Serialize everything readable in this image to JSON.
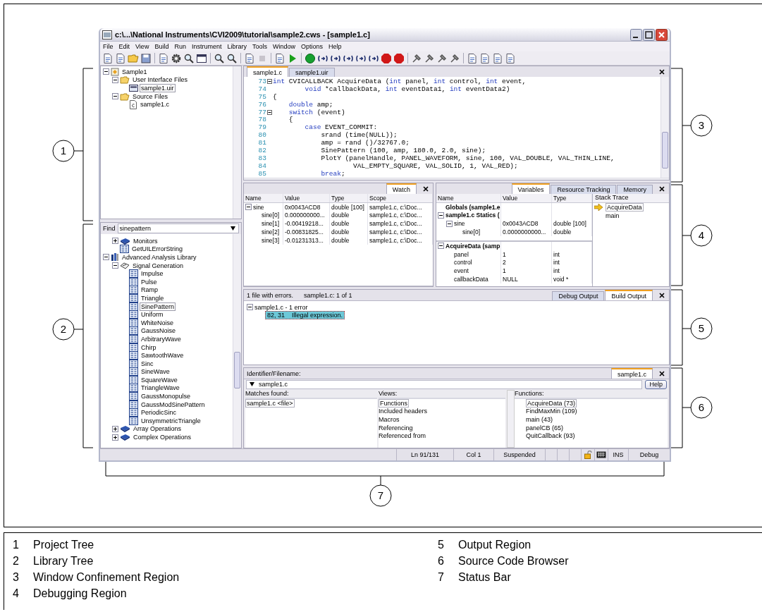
{
  "window": {
    "title": "c:\\...\\National Instruments\\CVI2009\\tutorial\\sample2.cws - [sample1.c]"
  },
  "menu": [
    "File",
    "Edit",
    "View",
    "Build",
    "Run",
    "Instrument",
    "Library",
    "Tools",
    "Window",
    "Options",
    "Help"
  ],
  "project_tree": [
    {
      "label": "Sample1",
      "kind": "project",
      "expanded": true,
      "selected": false,
      "children": [
        {
          "label": "User Interface Files",
          "kind": "folder",
          "expanded": true,
          "selected": false,
          "children": [
            {
              "label": "sample1.uir",
              "kind": "uir",
              "selected": true
            }
          ]
        },
        {
          "label": "Source Files",
          "kind": "folder",
          "expanded": true,
          "selected": false,
          "children": [
            {
              "label": "sample1.c",
              "kind": "c-file",
              "selected": false
            }
          ]
        }
      ]
    }
  ],
  "library": {
    "find_label": "Find",
    "find_value": "sinepattern",
    "tree": [
      {
        "children": [
          {
            "label": "Monitors",
            "kind": "class",
            "expanded": false,
            "selected": false
          },
          {
            "label": "GetUILErrorString",
            "kind": "function",
            "selected": false
          }
        ]
      },
      {
        "label": "Advanced Analysis Library",
        "kind": "library",
        "expanded": true,
        "selected": false,
        "children": [
          {
            "label": "Signal Generation",
            "kind": "category",
            "expanded": true,
            "selected": false,
            "children": [
              {
                "label": "Impulse",
                "kind": "function",
                "selected": false
              },
              {
                "label": "Pulse",
                "kind": "function",
                "selected": false
              },
              {
                "label": "Ramp",
                "kind": "function",
                "selected": false
              },
              {
                "label": "Triangle",
                "kind": "function",
                "selected": false
              },
              {
                "label": "SinePattern",
                "kind": "function",
                "selected": true
              },
              {
                "label": "Uniform",
                "kind": "function",
                "selected": false
              },
              {
                "label": "WhiteNoise",
                "kind": "function",
                "selected": false
              },
              {
                "label": "GaussNoise",
                "kind": "function",
                "selected": false
              },
              {
                "label": "ArbitraryWave",
                "kind": "function",
                "selected": false
              },
              {
                "label": "Chirp",
                "kind": "function",
                "selected": false
              },
              {
                "label": "SawtoothWave",
                "kind": "function",
                "selected": false
              },
              {
                "label": "Sinc",
                "kind": "function",
                "selected": false
              },
              {
                "label": "SineWave",
                "kind": "function",
                "selected": false
              },
              {
                "label": "SquareWave",
                "kind": "function",
                "selected": false
              },
              {
                "label": "TriangleWave",
                "kind": "function",
                "selected": false
              },
              {
                "label": "GaussMonopulse",
                "kind": "function",
                "selected": false
              },
              {
                "label": "GaussModSinePattern",
                "kind": "function",
                "selected": false
              },
              {
                "label": "PeriodicSinc",
                "kind": "function",
                "selected": false
              },
              {
                "label": "UnsymmetricTriangle",
                "kind": "function",
                "selected": false
              }
            ]
          },
          {
            "label": "Array Operations",
            "kind": "class",
            "expanded": false,
            "selected": false
          },
          {
            "label": "Complex Operations",
            "kind": "class",
            "expanded": false,
            "selected": false
          }
        ]
      }
    ]
  },
  "editor": {
    "tabs": [
      {
        "label": "sample1.c",
        "selected": true
      },
      {
        "label": "sample1.uir",
        "selected": false
      }
    ],
    "lines": [
      {
        "num": "73",
        "fold": true,
        "parts": [
          {
            "t": "int",
            "keyword": true
          },
          {
            "t": " CVICALLBACK AcquireData (",
            "keyword": false
          },
          {
            "t": "int",
            "keyword": true
          },
          {
            "t": " panel, ",
            "keyword": false
          },
          {
            "t": "int",
            "keyword": true
          },
          {
            "t": " control, ",
            "keyword": false
          },
          {
            "t": "int",
            "keyword": true
          },
          {
            "t": " event,",
            "keyword": false
          }
        ]
      },
      {
        "num": "74",
        "fold": false,
        "parts": [
          {
            "t": "        void",
            "keyword": true
          },
          {
            "t": " *callbackData, ",
            "keyword": false
          },
          {
            "t": "int",
            "keyword": true
          },
          {
            "t": " eventData1, ",
            "keyword": false
          },
          {
            "t": "int",
            "keyword": true
          },
          {
            "t": " eventData2)",
            "keyword": false
          }
        ]
      },
      {
        "num": "75",
        "fold": false,
        "parts": [
          {
            "t": "{",
            "keyword": false
          }
        ]
      },
      {
        "num": "76",
        "fold": false,
        "parts": [
          {
            "t": "    double",
            "keyword": true
          },
          {
            "t": " amp;",
            "keyword": false
          }
        ]
      },
      {
        "num": "77",
        "fold": true,
        "parts": [
          {
            "t": "    switch",
            "keyword": true
          },
          {
            "t": " (event)",
            "keyword": false
          }
        ]
      },
      {
        "num": "78",
        "fold": false,
        "parts": [
          {
            "t": "    {",
            "keyword": false
          }
        ]
      },
      {
        "num": "79",
        "fold": false,
        "parts": [
          {
            "t": "        case",
            "keyword": true
          },
          {
            "t": " EVENT_COMMIT:",
            "keyword": false
          }
        ]
      },
      {
        "num": "80",
        "fold": false,
        "parts": [
          {
            "t": "            srand (time(NULL));",
            "keyword": false
          }
        ]
      },
      {
        "num": "81",
        "fold": false,
        "parts": [
          {
            "t": "            amp = rand ()/32767.0;",
            "keyword": false
          }
        ]
      },
      {
        "num": "82",
        "fold": false,
        "parts": [
          {
            "t": "            SinePattern (100, amp, 180.0, 2.0, sine);",
            "keyword": false
          }
        ]
      },
      {
        "num": "83",
        "fold": false,
        "parts": [
          {
            "t": "            PlotY (panelHandle, PANEL_WAVEFORM, sine, 100, VAL_DOUBLE, VAL_THIN_LINE,",
            "keyword": false
          }
        ]
      },
      {
        "num": "84",
        "fold": false,
        "parts": [
          {
            "t": "                    VAL_EMPTY_SQUARE, VAL_SOLID, 1, VAL_RED);",
            "keyword": false
          }
        ]
      },
      {
        "num": "85",
        "fold": false,
        "parts": [
          {
            "t": "            break",
            "keyword": true
          },
          {
            "t": ";",
            "keyword": false
          }
        ]
      }
    ]
  },
  "watch": {
    "tab": "Watch",
    "columns": [
      "Name",
      "Value",
      "Type",
      "Scope"
    ],
    "rows": [
      {
        "name": "sine",
        "value": "0x0043ACD8",
        "type": "double [100]",
        "scope": "sample1.c, c:\\Doc...",
        "expanded": true,
        "children": [
          {
            "name": "sine[0]",
            "value": "0.000000000...",
            "type": "double",
            "scope": "sample1.c, c:\\Doc..."
          },
          {
            "name": "sine[1]",
            "value": "-0.00419218...",
            "type": "double",
            "scope": "sample1.c, c:\\Doc..."
          },
          {
            "name": "sine[2]",
            "value": "-0.00831825...",
            "type": "double",
            "scope": "sample1.c, c:\\Doc..."
          },
          {
            "name": "sine[3]",
            "value": "-0.01231313...",
            "type": "double",
            "scope": "sample1.c, c:\\Doc..."
          }
        ]
      }
    ]
  },
  "variables": {
    "tabs": [
      {
        "label": "Variables",
        "selected": true
      },
      {
        "label": "Resource Tracking",
        "selected": false
      },
      {
        "label": "Memory",
        "selected": false
      }
    ],
    "columns": [
      "Name",
      "Value",
      "Type"
    ],
    "upper": [
      {
        "kind": "scope",
        "name": "Globals (sample1.e"
      },
      {
        "kind": "scope",
        "name": "sample1.c Statics (",
        "expanded": true,
        "children": [
          {
            "kind": "variable",
            "name": "sine",
            "value": "0x0043ACD8",
            "type": "double [100]",
            "expanded": true,
            "children": [
              {
                "kind": "variable",
                "name": "sine[0]",
                "value": "0.0000000000...",
                "type": "double"
              }
            ]
          }
        ]
      }
    ],
    "lower": [
      {
        "kind": "scope",
        "name": "AcquireData (samp",
        "expanded": true,
        "children": [
          {
            "kind": "variable",
            "name": "panel",
            "value": "1",
            "type": "int"
          },
          {
            "kind": "variable",
            "name": "control",
            "value": "2",
            "type": "int"
          },
          {
            "kind": "variable",
            "name": "event",
            "value": "1",
            "type": "int"
          },
          {
            "kind": "variable",
            "name": "callbackData",
            "value": "NULL",
            "type": "void *"
          }
        ]
      }
    ],
    "stack_title": "Stack Trace",
    "stack": [
      {
        "label": "AcquireData",
        "current": true
      },
      {
        "label": "main",
        "current": false
      }
    ]
  },
  "output": {
    "summary": "1 file with errors.",
    "position": "sample1.c:  1 of 1",
    "tabs": [
      {
        "label": "Debug Output",
        "selected": false
      },
      {
        "label": "Build Output",
        "selected": true
      }
    ],
    "errors": [
      {
        "label": "sample1.c - 1 error",
        "expanded": true,
        "children": [
          {
            "location": "82, 31",
            "message": "Illegal expression.",
            "selected": true
          }
        ]
      }
    ]
  },
  "browser": {
    "label": "Identifier/Filename:",
    "tab": {
      "label": "sample1.c",
      "selected": true
    },
    "value": "sample1.c",
    "help": "Help",
    "matches_title": "Matches found:",
    "matches": [
      {
        "label": "sample1.c <file>",
        "selected": true
      }
    ],
    "views_title": "Views:",
    "views": [
      {
        "label": "Functions",
        "selected": true
      },
      {
        "label": "Included headers",
        "selected": false
      },
      {
        "label": "Macros",
        "selected": false
      },
      {
        "label": "Referencing",
        "selected": false
      },
      {
        "label": "Referenced from",
        "selected": false
      }
    ],
    "functions_title": "Functions:",
    "functions": [
      {
        "label": "AcquireData (73)",
        "selected": true
      },
      {
        "label": "FindMaxMin (109)",
        "selected": false
      },
      {
        "label": "main (43)",
        "selected": false
      },
      {
        "label": "panelCB (65)",
        "selected": false
      },
      {
        "label": "QuitCallback (93)",
        "selected": false
      }
    ]
  },
  "status_bar": {
    "line": "Ln 91/131",
    "column": "Col 1",
    "state": "Suspended",
    "insert_mode": "INS",
    "configuration": "Debug"
  },
  "callouts": [
    "1",
    "2",
    "3",
    "4",
    "5",
    "6",
    "7"
  ],
  "legend": [
    {
      "number": "1",
      "label": "Project Tree"
    },
    {
      "number": "2",
      "label": "Library Tree"
    },
    {
      "number": "3",
      "label": "Window Confinement Region"
    },
    {
      "number": "4",
      "label": "Debugging Region"
    },
    {
      "number": "5",
      "label": "Output Region"
    },
    {
      "number": "6",
      "label": "Source Code Browser"
    },
    {
      "number": "7",
      "label": "Status Bar"
    }
  ]
}
